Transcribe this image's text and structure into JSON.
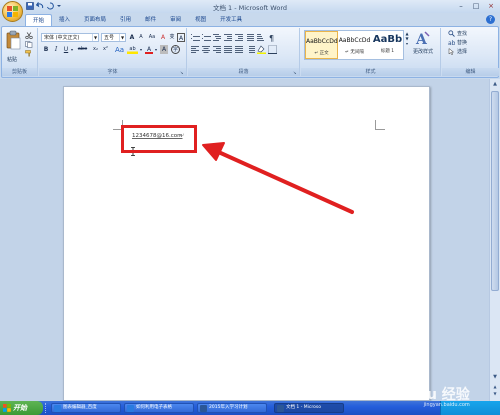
{
  "window": {
    "title": "文档 1 - Microsoft Word",
    "controls": [
      "–",
      "□",
      "×"
    ]
  },
  "ribbon_tabs": [
    {
      "label": "开始",
      "active": true
    },
    {
      "label": "插入",
      "active": false
    },
    {
      "label": "页面布局",
      "active": false
    },
    {
      "label": "引用",
      "active": false
    },
    {
      "label": "邮件",
      "active": false
    },
    {
      "label": "审阅",
      "active": false
    },
    {
      "label": "视图",
      "active": false
    },
    {
      "label": "开发工具",
      "active": false
    }
  ],
  "help": "?",
  "clipboard": {
    "group_label": "剪贴板",
    "paste_label": "粘贴"
  },
  "font": {
    "group_label": "字体",
    "font_name": "宋体 (中文正文)",
    "font_size": "五号",
    "grow": "A",
    "shrink": "A",
    "aa": "Aa",
    "clear": "A",
    "wen": "变",
    "A_box": "A",
    "bold": "B",
    "italic": "I",
    "underline": "U",
    "strike": "abe",
    "sub": "x₂",
    "sup": "x²",
    "highlight": "ab",
    "fontcolor": "A",
    "charshade": "A",
    "charcircle": "字"
  },
  "paragraph": {
    "group_label": "段落"
  },
  "styles": {
    "group_label": "样式",
    "items": [
      {
        "preview": "AaBbCcDd",
        "name": "↵ 正文",
        "selected": true
      },
      {
        "preview": "AaBbCcDd",
        "name": "↵ 无间隔",
        "selected": false
      },
      {
        "preview": "AaBb",
        "name": "标题 1",
        "selected": false
      }
    ],
    "change_label": "更改样式"
  },
  "editing": {
    "group_label": "编辑",
    "find": "查找",
    "replace": "替换",
    "select": "选择"
  },
  "document": {
    "email": "1234678@16.com",
    "paragraph_mark": "↵"
  },
  "taskbar": {
    "start_label": "开始",
    "items": [
      {
        "label": "图表编辑器_百度",
        "active": false
      },
      {
        "label": "如何利用电子表格",
        "active": false
      },
      {
        "label": "2015年入学习计划",
        "active": false
      },
      {
        "label": "文档 1 - Microso",
        "active": true
      }
    ],
    "colors": {
      "start": "#3b9a35",
      "bar": "#245edb",
      "accent": "#e02020"
    }
  },
  "watermark": {
    "brand": "Baidu 经验",
    "sub": "jingyan.baidu.com"
  }
}
